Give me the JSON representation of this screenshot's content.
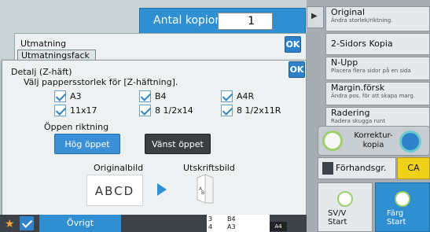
{
  "header": {
    "copies_label": "Antal kopior",
    "copies_value": "1"
  },
  "output": {
    "title": "Utmatning",
    "tray": "Utmatningsfack",
    "ok": "OK"
  },
  "detail": {
    "title": "Detalj (Z-häft)",
    "instruction": "Välj pappersstorlek för [Z-häftning].",
    "ok": "OK",
    "sizes": [
      "A3",
      "B4",
      "A4R",
      "11x17",
      "8 1/2x14",
      "8 1/2x11R"
    ],
    "opening_label": "Öppen riktning",
    "right_open": "Hög öppet",
    "left_open": "Vänst öppet",
    "original_label": "Originalbild",
    "print_label": "Utskriftsbild",
    "abcd": "ABCD"
  },
  "bottom": {
    "other": "Övrigt",
    "paper_rows": [
      {
        "num": "3",
        "size": "B4"
      },
      {
        "num": "4",
        "size": "A3"
      }
    ],
    "current_paper": "A4"
  },
  "right_panel": {
    "original": {
      "title": "Original",
      "sub": "Ändra storlek/riktning."
    },
    "duplex": {
      "title": "2-Sidors Kopia"
    },
    "nup": {
      "title": "N-Upp",
      "sub": "Placera flera sidor på en sida"
    },
    "margin": {
      "title": "Margin.försk",
      "sub": "Ändra pos. för att skapa marg."
    },
    "erase": {
      "title": "Radering",
      "sub": "Radera skugga runt"
    },
    "correction": "Korrektur-kopia",
    "preview": "Förhandsgr.",
    "ca": "CA",
    "bw_start": [
      "SV/V",
      "Start"
    ],
    "color_start": [
      "Färg",
      "Start"
    ]
  },
  "colors": {
    "accent": "#2f8fd1",
    "ca": "#f0d11a",
    "start_green": "#9ccf6c"
  }
}
